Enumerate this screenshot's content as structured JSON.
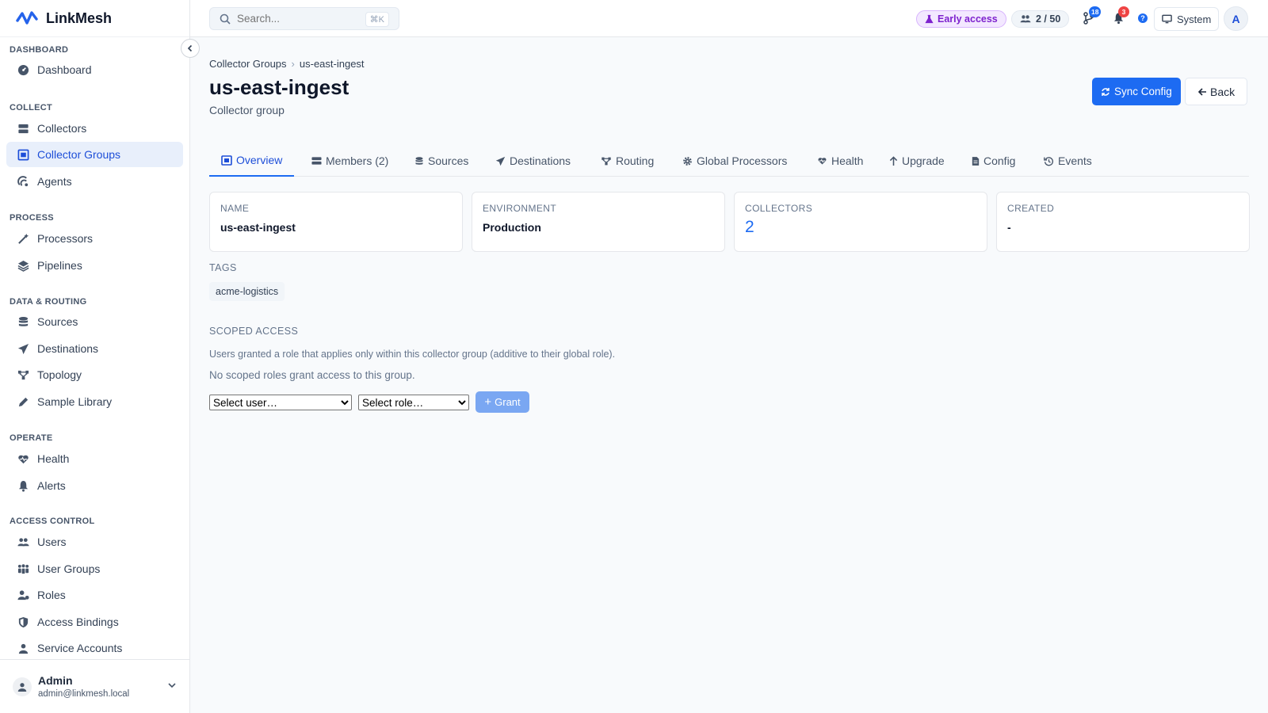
{
  "app": {
    "name": "LinkMesh"
  },
  "sidebar": {
    "sections": [
      {
        "title": "DASHBOARD",
        "items": [
          {
            "label": "Dashboard",
            "icon": "dashboard-icon"
          }
        ]
      },
      {
        "title": "COLLECT",
        "items": [
          {
            "label": "Collectors",
            "icon": "server-icon"
          },
          {
            "label": "Collector Groups",
            "icon": "group-icon",
            "active": true
          },
          {
            "label": "Agents",
            "icon": "agent-icon"
          }
        ]
      },
      {
        "title": "PROCESS",
        "items": [
          {
            "label": "Processors",
            "icon": "wand-icon"
          },
          {
            "label": "Pipelines",
            "icon": "layers-icon"
          }
        ]
      },
      {
        "title": "DATA & ROUTING",
        "items": [
          {
            "label": "Sources",
            "icon": "database-icon"
          },
          {
            "label": "Destinations",
            "icon": "send-icon"
          },
          {
            "label": "Topology",
            "icon": "topology-icon"
          },
          {
            "label": "Sample Library",
            "icon": "pencil-icon"
          }
        ]
      },
      {
        "title": "OPERATE",
        "items": [
          {
            "label": "Health",
            "icon": "heart-pulse-icon"
          },
          {
            "label": "Alerts",
            "icon": "bell-icon"
          }
        ]
      },
      {
        "title": "ACCESS CONTROL",
        "items": [
          {
            "label": "Users",
            "icon": "users-icon"
          },
          {
            "label": "User Groups",
            "icon": "user-groups-icon"
          },
          {
            "label": "Roles",
            "icon": "user-role-icon"
          },
          {
            "label": "Access Bindings",
            "icon": "shield-icon"
          },
          {
            "label": "Service Accounts",
            "icon": "service-account-icon"
          }
        ]
      }
    ],
    "user": {
      "name": "Admin",
      "email": "admin@linkmesh.local"
    }
  },
  "topbar": {
    "search_placeholder": "Search...",
    "search_shortcut": "⌘K",
    "early_access": "Early access",
    "seats": "2 / 50",
    "merge_badge": "18",
    "notif_badge": "3",
    "help_glyph": "?",
    "theme": "System",
    "avatar_initial": "A"
  },
  "page": {
    "breadcrumb": [
      "Collector Groups",
      "us-east-ingest"
    ],
    "title": "us-east-ingest",
    "subtitle": "Collector group",
    "sync_label": "Sync Config",
    "back_label": "Back",
    "tabs": [
      {
        "label": "Overview",
        "icon": "overview-icon",
        "active": true
      },
      {
        "label": "Members (2)",
        "icon": "server-icon"
      },
      {
        "label": "Sources",
        "icon": "database-icon"
      },
      {
        "label": "Destinations",
        "icon": "send-icon"
      },
      {
        "label": "Routing",
        "icon": "routing-icon"
      },
      {
        "label": "Global Processors",
        "icon": "gear-icon"
      },
      {
        "label": "Health",
        "icon": "heart-pulse-icon"
      },
      {
        "label": "Upgrade",
        "icon": "arrow-up-icon"
      },
      {
        "label": "Config",
        "icon": "file-icon"
      },
      {
        "label": "Events",
        "icon": "history-icon"
      }
    ],
    "cards": [
      {
        "label": "NAME",
        "value": "us-east-ingest"
      },
      {
        "label": "ENVIRONMENT",
        "value": "Production"
      },
      {
        "label": "COLLECTORS",
        "value": "2"
      },
      {
        "label": "CREATED",
        "value": "-"
      }
    ],
    "tags_label": "TAGS",
    "tags": [
      "acme-logistics"
    ],
    "scoped": {
      "title": "SCOPED ACCESS",
      "help": "Users granted a role that applies only within this collector group (additive to their global role).",
      "empty": "No scoped roles grant access to this group.",
      "user_select": "Select user…",
      "role_select": "Select role…",
      "grant_label": "Grant"
    }
  },
  "colors": {
    "accent": "#1d6bf2",
    "active_bg": "#e8effb",
    "early_bg": "#f3e8ff",
    "badge_blue": "#1d6bf2",
    "badge_red": "#ef4444"
  }
}
